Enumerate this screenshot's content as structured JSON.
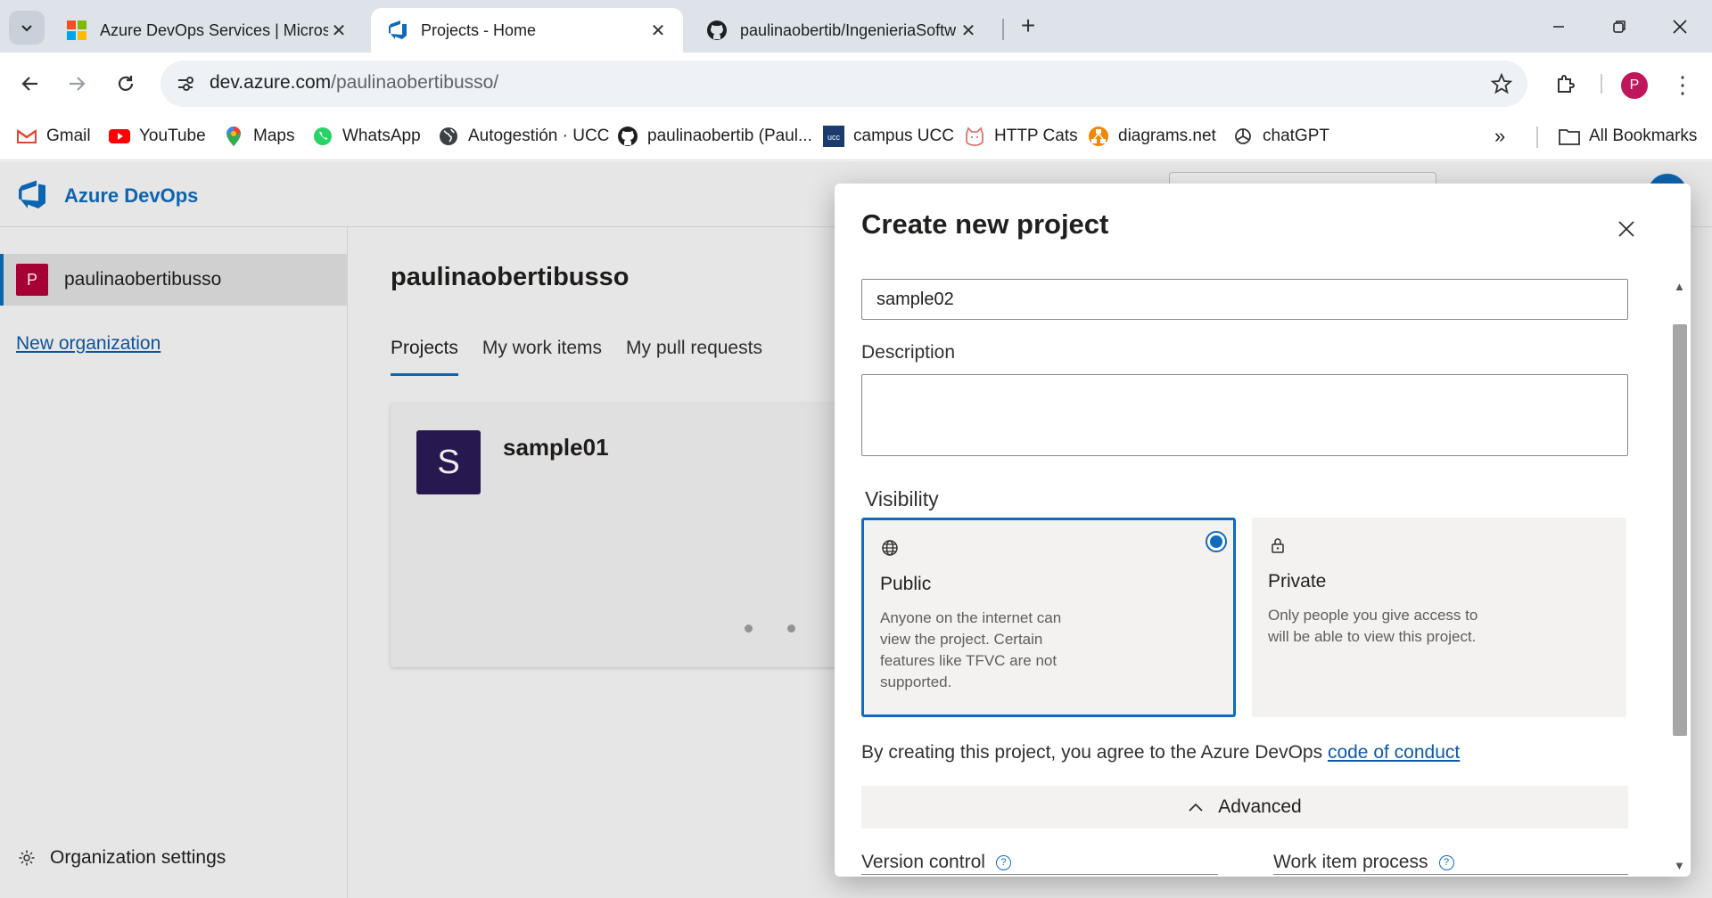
{
  "browser": {
    "tabs": [
      {
        "title": "Azure DevOps Services | Micros",
        "active": false
      },
      {
        "title": "Projects - Home",
        "active": true
      },
      {
        "title": "paulinaobertib/IngenieriaSoftw",
        "active": false
      }
    ],
    "url_domain": "dev.azure.com",
    "url_path": "/paulinaobertibusso/",
    "profile_initial": "P",
    "bookmarks": [
      {
        "label": "Gmail",
        "icon": "gmail-icon"
      },
      {
        "label": "YouTube",
        "icon": "youtube-icon"
      },
      {
        "label": "Maps",
        "icon": "maps-icon"
      },
      {
        "label": "WhatsApp",
        "icon": "whatsapp-icon"
      },
      {
        "label": "Autogestión · UCC",
        "icon": "globe-icon"
      },
      {
        "label": "paulinaobertib (Paul...",
        "icon": "github-icon"
      },
      {
        "label": "campus UCC",
        "icon": "ucc-icon"
      },
      {
        "label": "HTTP Cats",
        "icon": "cat-icon"
      },
      {
        "label": "diagrams.net",
        "icon": "diagrams-icon"
      },
      {
        "label": "chatGPT",
        "icon": "openai-icon"
      }
    ],
    "all_bookmarks_label": "All Bookmarks"
  },
  "ado": {
    "brand": "Azure DevOps",
    "org_initial": "P",
    "org_name": "paulinaobertibusso",
    "new_org_label": "New organization",
    "org_settings_label": "Organization settings",
    "page_title": "paulinaobertibusso",
    "tabs": [
      "Projects",
      "My work items",
      "My pull requests"
    ],
    "project": {
      "initial": "S",
      "name": "sample01"
    }
  },
  "dialog": {
    "title": "Create new project",
    "project_name_value": "sample02",
    "description_label": "Description",
    "visibility_label": "Visibility",
    "visibility_options": [
      {
        "title": "Public",
        "description": "Anyone on the internet can view the project. Certain features like TFVC are not supported.",
        "selected": true,
        "icon": "globe-icon"
      },
      {
        "title": "Private",
        "description": "Only people you give access to will be able to view this project.",
        "selected": false,
        "icon": "lock-icon"
      }
    ],
    "agreement_text": "By creating this project, you agree to the Azure DevOps ",
    "agreement_link": "code of conduct",
    "advanced_label": "Advanced",
    "version_control_label": "Version control",
    "work_item_process_label": "Work item process",
    "help_glyph": "?"
  },
  "colors": {
    "accent": "#0f6cbd",
    "org_avatar": "#b4003c",
    "project_avatar": "#2b1a55",
    "profile": "#c0165b"
  }
}
